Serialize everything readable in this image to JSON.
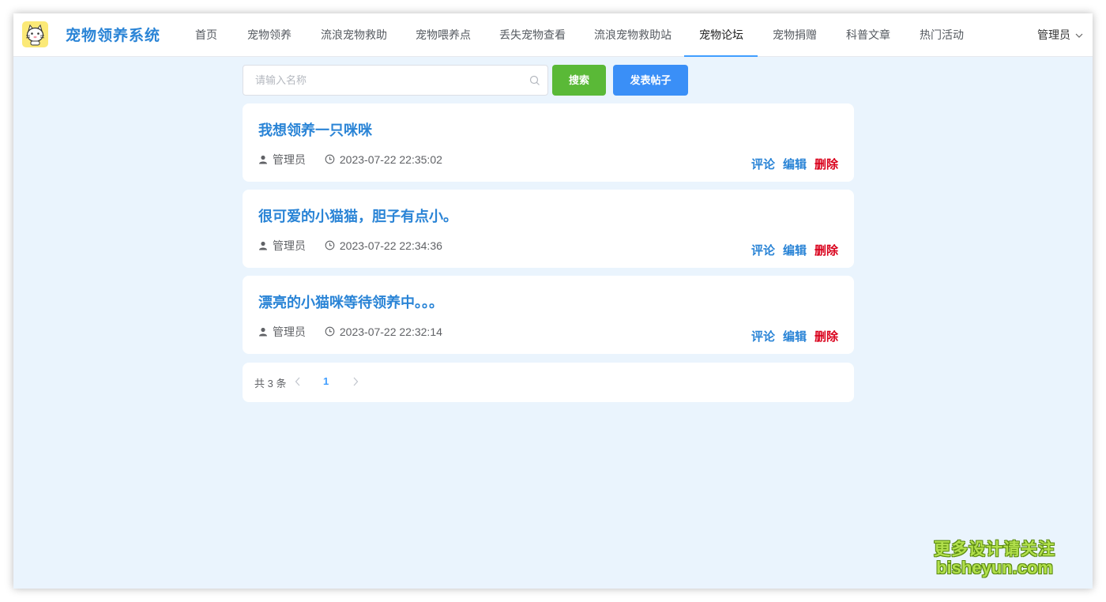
{
  "app": {
    "brand": "宠物领养系统",
    "brand_color": "#2a84d6"
  },
  "nav": {
    "items": [
      {
        "label": "首页"
      },
      {
        "label": "宠物领养"
      },
      {
        "label": "流浪宠物救助"
      },
      {
        "label": "宠物喂养点"
      },
      {
        "label": "丢失宠物查看"
      },
      {
        "label": "流浪宠物救助站"
      },
      {
        "label": "宠物论坛",
        "active": true
      },
      {
        "label": "宠物捐赠"
      },
      {
        "label": "科普文章"
      },
      {
        "label": "热门活动"
      }
    ],
    "user": "管理员"
  },
  "search": {
    "placeholder": "请输入名称",
    "value": "",
    "search_label": "搜索",
    "post_label": "发表帖子"
  },
  "posts": [
    {
      "title": "我想领养一只咪咪",
      "author": "管理员",
      "time": "2023-07-22 22:35:02"
    },
    {
      "title": "很可爱的小猫猫，胆子有点小。",
      "author": "管理员",
      "time": "2023-07-22 22:34:36"
    },
    {
      "title": "漂亮的小猫咪等待领养中。。。",
      "author": "管理员",
      "time": "2023-07-22 22:32:14"
    }
  ],
  "actions": {
    "comment": "评论",
    "edit": "编辑",
    "delete": "删除"
  },
  "pagination": {
    "total_text": "共 3 条",
    "current_page": "1"
  },
  "watermark": {
    "line1": "更多设计请关注",
    "line2": "bisheyun.com"
  },
  "colors": {
    "accent": "#409eff",
    "search_button": "#5ab937",
    "post_button": "#3a8ff7",
    "delete": "#d9001b",
    "background": "#eaf4fd"
  }
}
